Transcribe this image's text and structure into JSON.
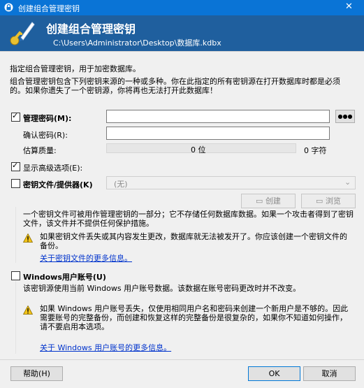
{
  "window": {
    "title": "创建组合管理密钥",
    "close_icon": "close-icon"
  },
  "banner": {
    "title": "创建组合管理密钥",
    "path": "C:\\Users\\Administrator\\Desktop\\数据库.kdbx"
  },
  "intro": {
    "line1": "指定组合管理密钥，用于加密数据库。",
    "line2": "组合管理密钥包含下列密钥来源的一种或多种。你在此指定的所有密钥源在打开数据库时都是必须的。如果你遗失了一个密钥源，你将再也无法打开此数据库！"
  },
  "master_password": {
    "label": "管理密码(M):",
    "checked": true,
    "value": "",
    "reveal_button": "●●●",
    "repeat_label": "确认密码(R):",
    "repeat_value": "",
    "quality_label": "估算质量:",
    "quality_bits": "0 位",
    "quality_chars": "0 字符"
  },
  "advanced": {
    "label": "显示高级选项(E):",
    "checked": true
  },
  "key_file": {
    "label": "密钥文件/提供器(K)",
    "checked": false,
    "select_value": "(无)",
    "create_button": "创建",
    "browse_button": "浏览",
    "description": "一个密钥文件可被用作管理密钥的一部分；它不存储任何数据库数据。如果一个攻击者得到了密钥文件，该文件并不提供任何保护措施。",
    "warning": "如果密钥文件丢失或其内容发生更改，数据库就无法被发开了。你应该创建一个密钥文件的备份。",
    "more_link": "关于密钥文件的更多信息。"
  },
  "windows_account": {
    "label": "Windows用户账号(U)",
    "checked": false,
    "description": "该密钥源使用当前 Windows 用户账号数据。该数据在账号密码更改时并不改变。",
    "warning": "如果 Windows 用户账号丢失，仅使用相同用户名和密码来创建一个新用户是不够的。因此需要账号的完整备份，而创建和恢复这样的完整备份是很复杂的，如果你不知道如何操作，请不要启用本选项。",
    "more_link": "关于 Windows 用户账号的更多信息。"
  },
  "footer": {
    "help_button": "帮助(H)",
    "ok_button": "OK",
    "cancel_button": "取消"
  }
}
